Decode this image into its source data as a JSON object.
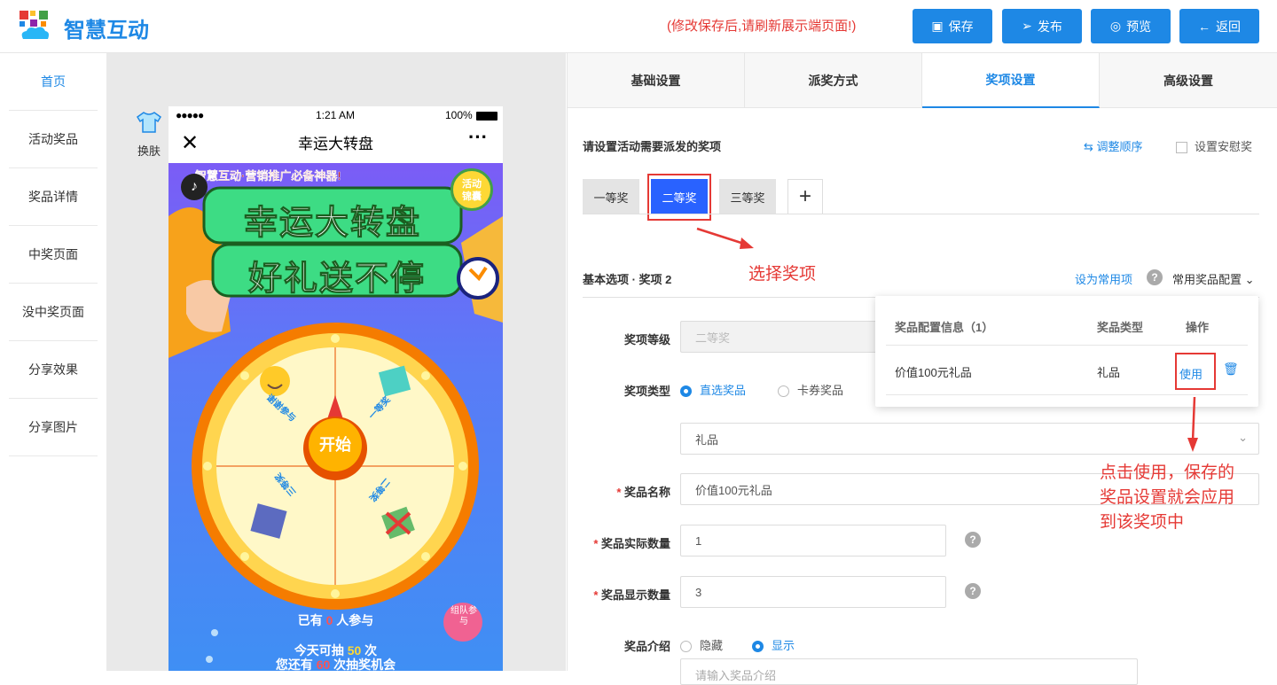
{
  "app": {
    "brand": "智慧互动",
    "notice": "(修改保存后,请刷新展示端页面!)"
  },
  "toolbar": {
    "save": "保存",
    "publish": "发布",
    "preview": "预览",
    "back": "返回"
  },
  "sidebar": {
    "items": [
      "首页",
      "活动奖品",
      "奖品详情",
      "中奖页面",
      "没中奖页面",
      "分享效果",
      "分享图片"
    ]
  },
  "preview": {
    "skin_label": "换肤",
    "status": {
      "time": "1:21 AM",
      "battery": "100%"
    },
    "nav_title": "幸运大转盘",
    "banner": "智慧互动·营销推广必备神器!",
    "badge": "活动锦囊",
    "title_line1": "幸运大转盘",
    "title_line2": "好礼送不停",
    "wheel_slots": [
      "谢谢参与",
      "一等奖",
      "三等奖",
      "二等奖"
    ],
    "start": "开始",
    "participants_prefix": "已有",
    "participants_count": "0",
    "participants_suffix": "人参与",
    "today_prefix": "今天可抽",
    "today_count": "50",
    "today_suffix": "次",
    "remain_prefix": "您还有",
    "remain_count": "60",
    "remain_suffix": "次抽奖机会",
    "team": "组队参与"
  },
  "settings": {
    "tabs": [
      "基础设置",
      "派奖方式",
      "奖项设置",
      "高级设置"
    ],
    "section_title": "请设置活动需要派发的奖项",
    "adjust_order": "调整顺序",
    "consolation": "设置安慰奖",
    "prize_tabs": [
      "一等奖",
      "二等奖",
      "三等奖"
    ],
    "add": "+",
    "annotation_select": "选择奖项",
    "basic_title": "基本选项 · 奖项 2",
    "set_common": "设为常用项",
    "common_config": "常用奖品配置",
    "fields": {
      "level_label": "奖项等级",
      "level_value": "二等奖",
      "type_label": "奖项类型",
      "type_opt1": "直选奖品",
      "type_opt2": "卡券奖品",
      "category_value": "礼品",
      "name_label": "奖品名称",
      "name_value": "价值100元礼品",
      "actual_label": "奖品实际数量",
      "actual_value": "1",
      "display_label": "奖品显示数量",
      "display_value": "3",
      "intro_label": "奖品介绍",
      "intro_hide": "隐藏",
      "intro_show": "显示",
      "intro_placeholder": "请输入奖品介绍"
    },
    "popup": {
      "col1": "奖品配置信息（1）",
      "col2": "奖品类型",
      "col3": "操作",
      "row_info": "价值100元礼品",
      "row_type": "礼品",
      "use": "使用"
    },
    "annotation_use": [
      "点击使用，保存的",
      "奖品设置就会应用",
      "到该奖项中"
    ]
  },
  "colors": {
    "accent": "#1e88e5",
    "annotation": "#e53935"
  }
}
